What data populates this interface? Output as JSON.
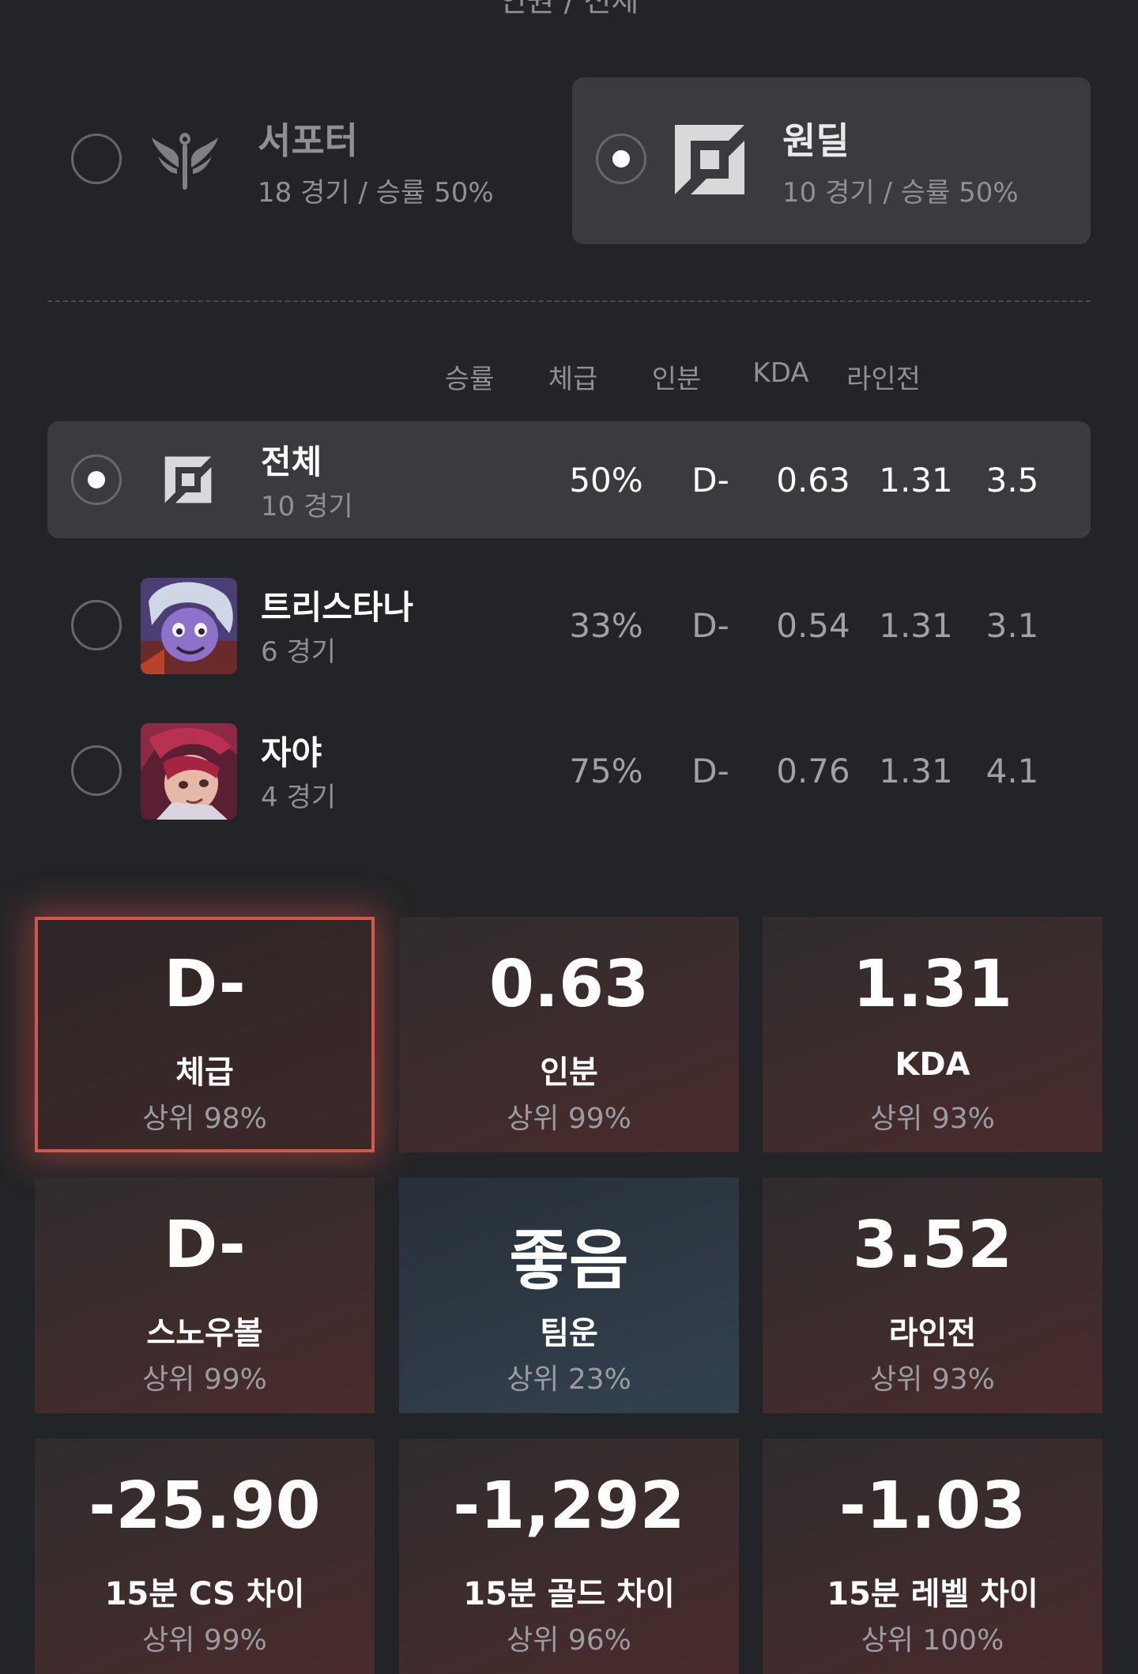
{
  "header": {
    "partial_title": "인원 / 전체"
  },
  "roles": [
    {
      "name": "서포터",
      "sub": "18 경기 / 승률 50%",
      "icon": "support-wings-icon",
      "selected": false
    },
    {
      "name": "원딜",
      "sub": "10 경기 / 승률 50%",
      "icon": "adc-square-icon",
      "selected": true
    }
  ],
  "table": {
    "headers": [
      "승률",
      "체급",
      "인분",
      "KDA",
      "라인전"
    ],
    "rows": [
      {
        "name": "전체",
        "games": "10 경기",
        "winrate": "50%",
        "tier": "D-",
        "share": "0.63",
        "kda": "1.31",
        "lane": "3.5",
        "selected": true
      },
      {
        "name": "트리스타나",
        "games": "6 경기",
        "winrate": "33%",
        "tier": "D-",
        "share": "0.54",
        "kda": "1.31",
        "lane": "3.1",
        "selected": false
      },
      {
        "name": "자야",
        "games": "4 경기",
        "winrate": "75%",
        "tier": "D-",
        "share": "0.76",
        "kda": "1.31",
        "lane": "4.1",
        "selected": false
      }
    ]
  },
  "tiles": [
    {
      "value": "D-",
      "label": "체급",
      "rank": "상위 98%"
    },
    {
      "value": "0.63",
      "label": "인분",
      "rank": "상위 99%"
    },
    {
      "value": "1.31",
      "label": "KDA",
      "rank": "상위 93%"
    },
    {
      "value": "D-",
      "label": "스노우볼",
      "rank": "상위 99%"
    },
    {
      "value": "좋음",
      "label": "팀운",
      "rank": "상위 23%"
    },
    {
      "value": "3.52",
      "label": "라인전",
      "rank": "상위 93%"
    },
    {
      "value": "-25.90",
      "label": "15분 CS 차이",
      "rank": "상위 99%"
    },
    {
      "value": "-1,292",
      "label": "15분 골드 차이",
      "rank": "상위 96%"
    },
    {
      "value": "-1.03",
      "label": "15분 레벨 차이",
      "rank": "상위 100%"
    }
  ],
  "colors": {
    "background": "#232427",
    "selected": "#3a3b3f",
    "highlight": "#d2584f",
    "good_tile": "#33414f"
  }
}
